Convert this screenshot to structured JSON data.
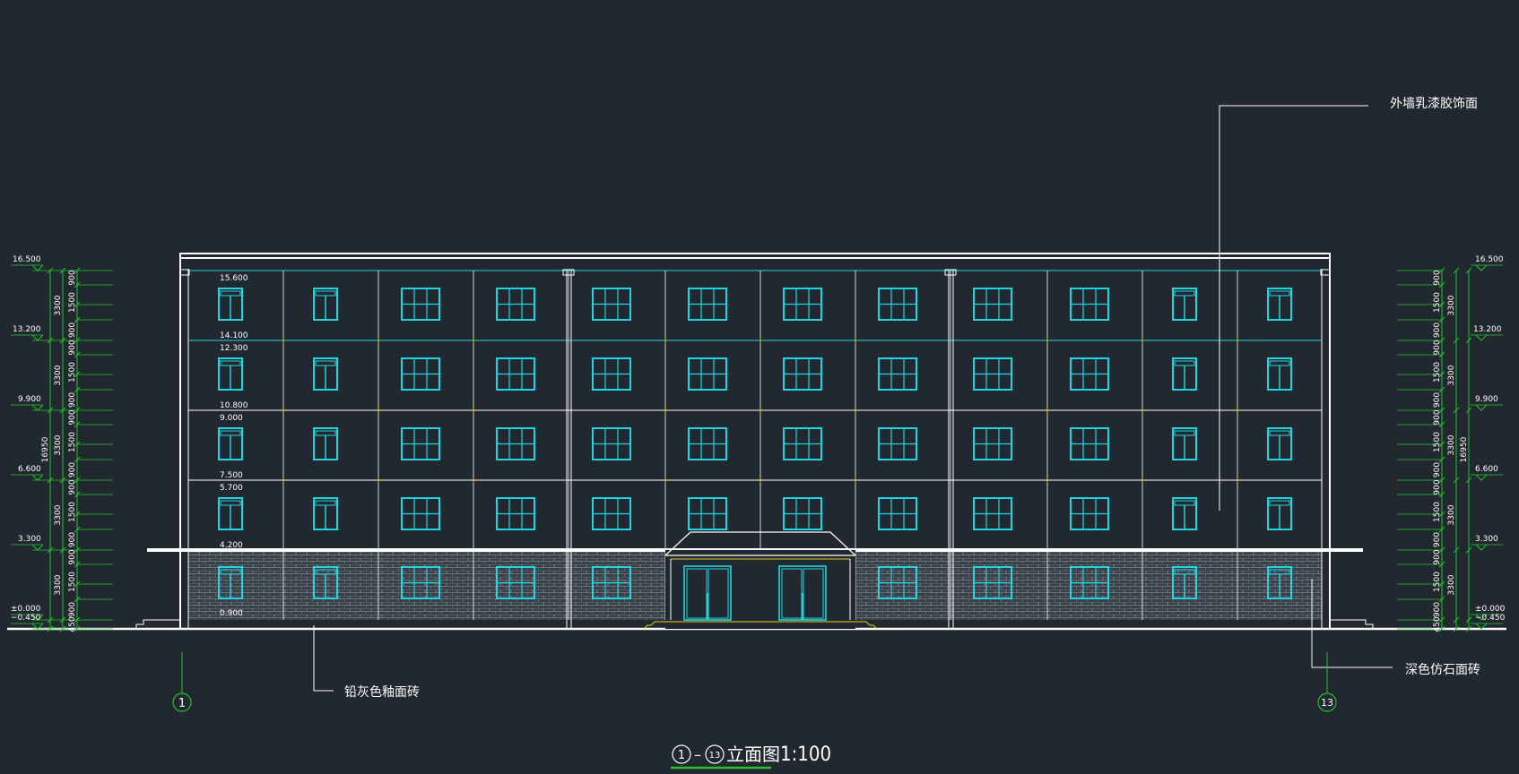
{
  "drawing": {
    "title_axis_start": "1",
    "title_dash": "–",
    "title_axis_end": "13",
    "title_text": "立面图",
    "title_scale": "1:100"
  },
  "annotations": {
    "top_right": "外墙乳漆胶饰面",
    "bottom_left": "铅灰色釉面砖",
    "bottom_right": "深色仿石面砖"
  },
  "axes": {
    "left": "1",
    "right": "13"
  },
  "elevations_left": [
    "16.500",
    "13.200",
    "9.900",
    "6.600",
    "3.300",
    "±0.000",
    "−0.450"
  ],
  "elevations_right": [
    "16.500",
    "13.200",
    "9.900",
    "6.600",
    "3.300",
    "±0.000",
    "−0.450"
  ],
  "window_levels": [
    "15.600",
    "14.100",
    "12.300",
    "10.800",
    "9.000",
    "7.500",
    "5.700",
    "4.200",
    "0.900"
  ],
  "dims_inner_left": [
    "450",
    "900",
    "1500",
    "900",
    "900",
    "1500",
    "900",
    "900",
    "1500",
    "900",
    "900",
    "1500",
    "900",
    "900",
    "1500",
    "900"
  ],
  "dims_mid_left": [
    "3300",
    "3300",
    "3300",
    "3300",
    "3300"
  ],
  "dims_total_left": "16950",
  "dims_inner_right": [
    "450",
    "900",
    "1500",
    "900",
    "900",
    "1500",
    "900",
    "900",
    "1500",
    "900",
    "900",
    "1500",
    "900",
    "900",
    "1500",
    "900"
  ],
  "dims_mid_right": [
    "3300",
    "3300",
    "3300",
    "3300",
    "3300"
  ],
  "dims_total_right": "16950",
  "colors": {
    "background": "#212830",
    "outline": "#ffffff",
    "window": "#22d6e0",
    "dimension": "#22c32a",
    "accent": "#e6d21a"
  }
}
